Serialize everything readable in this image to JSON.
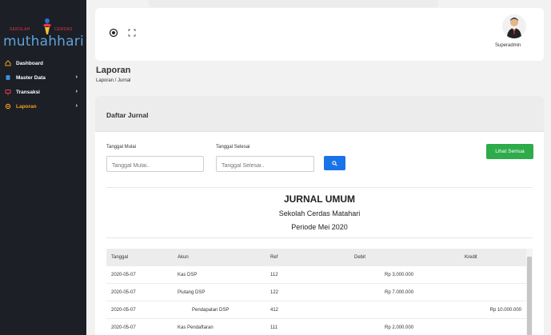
{
  "sidebar": {
    "logo": {
      "left_text": "SEKOLAH",
      "right_text": "CERDAS",
      "brand": "muthahhari"
    },
    "items": [
      {
        "label": "Dashboard",
        "icon": "home-icon",
        "has_chevron": false,
        "active": false
      },
      {
        "label": "Master Data",
        "icon": "database-icon",
        "has_chevron": true,
        "active": false
      },
      {
        "label": "Transaksi",
        "icon": "monitor-icon",
        "has_chevron": true,
        "active": false
      },
      {
        "label": "Laporan",
        "icon": "settings-icon",
        "has_chevron": true,
        "active": true
      }
    ],
    "chevron": "›"
  },
  "topbar": {
    "user_name": "Superadmin",
    "icons": [
      "toggle-icon",
      "fullscreen-icon"
    ]
  },
  "page": {
    "title": "Laporan",
    "breadcrumb": "Laporan / Jurnal"
  },
  "card": {
    "title": "Daftar Jurnal",
    "start_label": "Tanggal Mulai",
    "start_placeholder": "Tanggal Mulai..",
    "end_label": "Tanggal Selesai",
    "end_placeholder": "Tanggal Selesai..",
    "show_all_label": "Lihat Semua"
  },
  "report": {
    "title": "JURNAL UMUM",
    "school": "Sekolah Cerdas Matahari",
    "period": "Periode Mei 2020"
  },
  "table": {
    "headers": {
      "date": "Tanggal",
      "account": "Akun",
      "ref": "Ref",
      "debit": "Debit",
      "credit": "Kredit"
    },
    "rows": [
      {
        "date": "2020-05-07",
        "account": "Kas DSP",
        "ref": "112",
        "debit": "Rp 3.000.000",
        "credit": "",
        "indent": false
      },
      {
        "date": "2020-05-07",
        "account": "Piutang DSP",
        "ref": "122",
        "debit": "Rp 7.000.000",
        "credit": "",
        "indent": false
      },
      {
        "date": "2020-05-07",
        "account": "Pendapatan DSP",
        "ref": "412",
        "debit": "",
        "credit": "Rp 10.000.000",
        "indent": true
      },
      {
        "date": "2020-05-07",
        "account": "Kas Pendaftaran",
        "ref": "111",
        "debit": "Rp 2.000.000",
        "credit": "",
        "indent": false
      }
    ]
  },
  "colors": {
    "sidebar_bg": "#1c1f26",
    "active_menu": "#f2a21a",
    "brand_blue": "#5fa3d8",
    "search_button": "#1a73e8",
    "show_all_button": "#2eab4a"
  }
}
